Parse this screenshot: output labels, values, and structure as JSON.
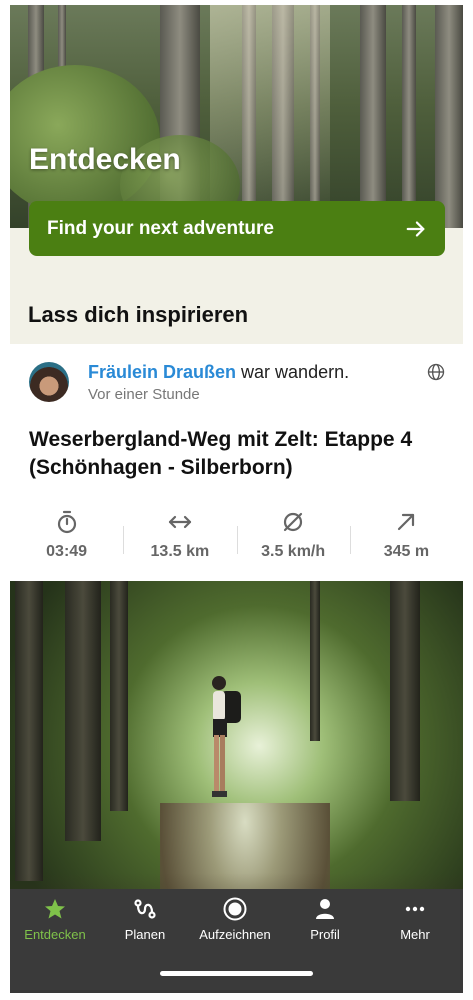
{
  "hero": {
    "title": "Entdecken"
  },
  "cta": {
    "label": "Find your next adventure"
  },
  "section": {
    "title": "Lass dich inspirieren"
  },
  "post": {
    "author": "Fräulein Draußen",
    "action": "war wandern.",
    "time_ago": "Vor einer Stunde",
    "tour_title": "Weserbergland-Weg mit Zelt: Etappe 4 (Schönhagen - Silberborn)",
    "stats": [
      {
        "icon": "stopwatch-icon",
        "value": "03:49"
      },
      {
        "icon": "distance-arrows-icon",
        "value": "13.5 km"
      },
      {
        "icon": "average-speed-icon",
        "value": "3.5 km/h"
      },
      {
        "icon": "elevation-arrow-icon",
        "value": "345 m"
      }
    ]
  },
  "tabs": [
    {
      "label": "Entdecken",
      "icon": "star-icon",
      "active": true
    },
    {
      "label": "Planen",
      "icon": "route-icon",
      "active": false
    },
    {
      "label": "Aufzeichnen",
      "icon": "record-icon",
      "active": false
    },
    {
      "label": "Profil",
      "icon": "person-icon",
      "active": false
    },
    {
      "label": "Mehr",
      "icon": "more-icon",
      "active": false
    }
  ],
  "colors": {
    "accent": "#4b7f12",
    "active_tab": "#7fc24a",
    "link": "#2a8ad6",
    "tabbar": "#3a3a3a"
  }
}
